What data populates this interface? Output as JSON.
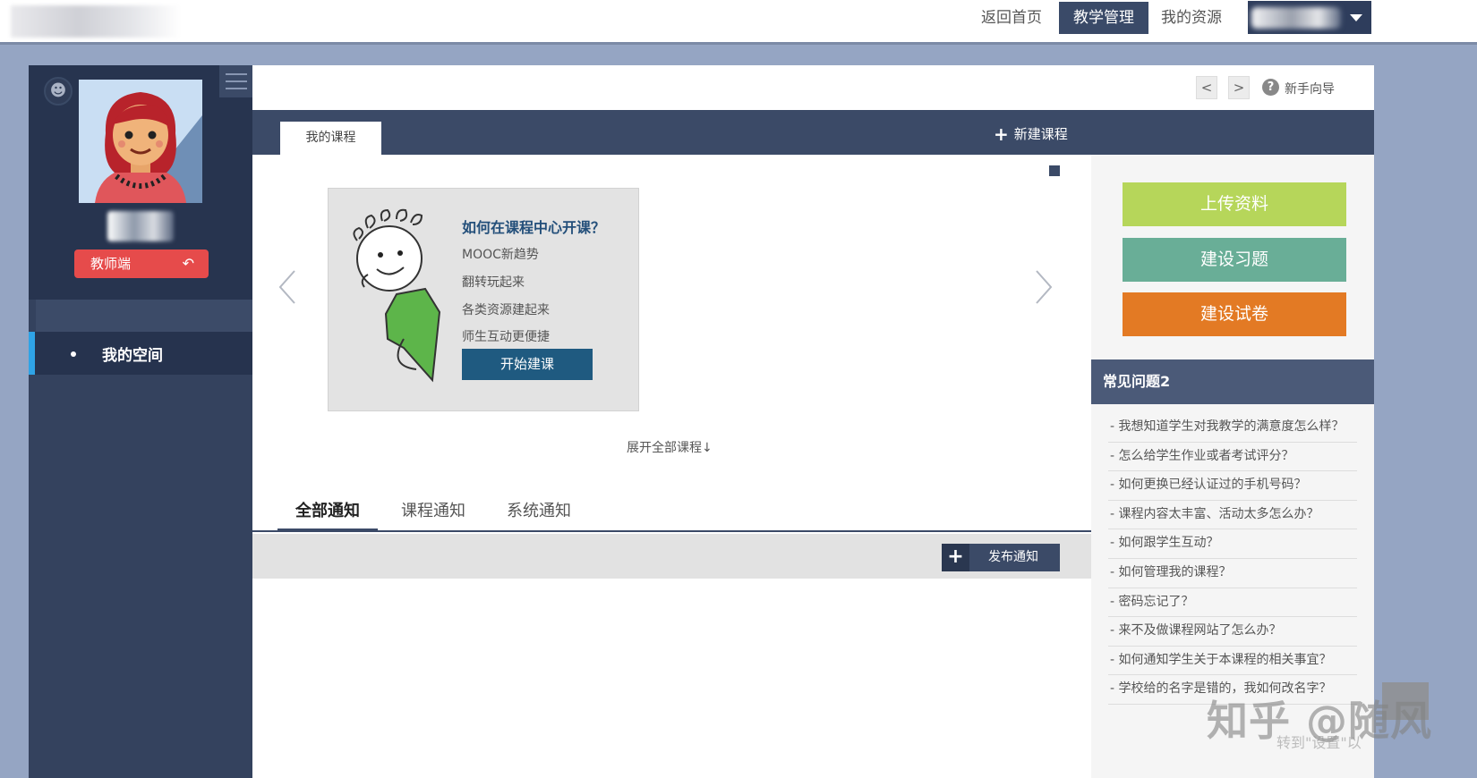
{
  "topnav": {
    "home": "返回首页",
    "teaching": "教学管理",
    "resources": "我的资源"
  },
  "sidebar": {
    "role_button": "教师端",
    "role_swap_icon": "swap-icon",
    "menu_item": "我的空间"
  },
  "toolbar": {
    "prev": "<",
    "next": ">",
    "help_icon": "?",
    "guide": "新手向导"
  },
  "courses": {
    "tab_label": "我的课程",
    "new_course": "新建课程",
    "card": {
      "title": "如何在课程中心开课？",
      "lines": [
        "MOOC新趋势",
        "翻转玩起来",
        "各类资源建起来",
        "师生互动更便捷"
      ],
      "button": "开始建课"
    },
    "expand_link": "展开全部课程↓"
  },
  "notices": {
    "tabs": [
      "全部通知",
      "课程通知",
      "系统通知"
    ],
    "publish_button": "发布通知"
  },
  "actions": {
    "upload": "上传资料",
    "exercise": "建设习题",
    "exam": "建设试卷"
  },
  "faq": {
    "title": "常见问题2",
    "items": [
      "- 我想知道学生对我教学的满意度怎么样？",
      "- 怎么给学生作业或者考试评分？",
      "- 如何更换已经认证过的手机号码？",
      "- 课程内容太丰富、活动太多怎么办？",
      "- 如何跟学生互动？",
      "- 如何管理我的课程？",
      "- 密码忘记了？",
      "- 来不及做课程网站了怎么办？",
      "- 如何通知学生关于本课程的相关事宜？",
      "- 学校给的名字是错的，我如何改名字？"
    ]
  },
  "watermark": {
    "text": "知乎 @随风",
    "sub": "转到\"设置\"以"
  },
  "colors": {
    "nav_dark": "#3b4a67",
    "sidebar": "#34425e",
    "accent_blue": "#2fa3e6",
    "role_red": "#e64b4b",
    "upload_green": "#b6d65a",
    "exercise_teal": "#69ae97",
    "exam_orange": "#e37a24"
  }
}
